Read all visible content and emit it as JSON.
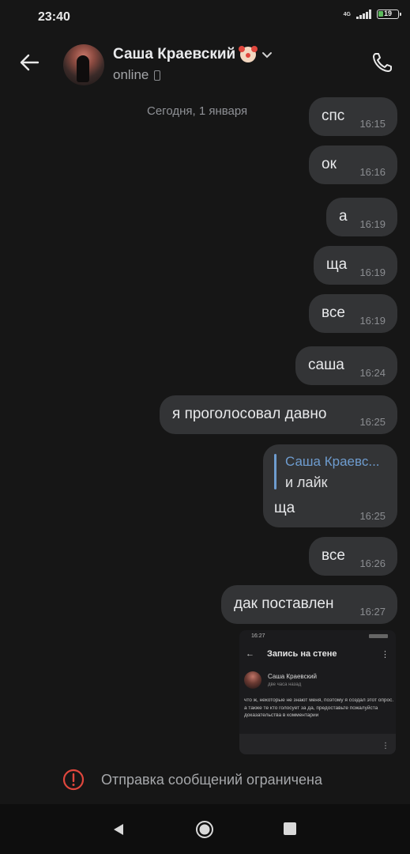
{
  "status_bar": {
    "time": "23:40",
    "network": "4G",
    "battery": "19"
  },
  "header": {
    "back_icon": "arrow-left-icon",
    "name": "Саша Краевский",
    "status": "online",
    "call_icon": "phone-icon"
  },
  "date_separator": "Сегодня, 1 января",
  "messages": [
    {
      "text": "спс",
      "time": "16:15"
    },
    {
      "text": "ок",
      "time": "16:16"
    },
    {
      "text": "а",
      "time": "16:19"
    },
    {
      "text": "ща",
      "time": "16:19"
    },
    {
      "text": "все",
      "time": "16:19"
    },
    {
      "text": "саша",
      "time": "16:24"
    },
    {
      "text": "я проголосовал давно",
      "time": "16:25"
    }
  ],
  "reply_message": {
    "quoted_name": "Саша Краевс...",
    "quoted_text": "и лайк",
    "text": "ща",
    "time": "16:25"
  },
  "messages_after": [
    {
      "text": "все",
      "time": "16:26"
    },
    {
      "text": "дак поставлен",
      "time": "16:27"
    }
  ],
  "screenshot_attachment": {
    "time": "16:27",
    "title": "Запись на стене",
    "author": "Саша Краевский",
    "subtitle": "две часа назад",
    "body": "что ж, некоторые не знают меня, поэтому я создал этот опрос. а также те кто голосует за да, предоставьте пожалуйста доказательства в комментарии"
  },
  "restriction": {
    "text": "Отправка сообщений ограничена"
  },
  "colors": {
    "background": "#161616",
    "bubble": "#333436",
    "accent": "#6e9ccf",
    "warning": "#e0473d"
  }
}
